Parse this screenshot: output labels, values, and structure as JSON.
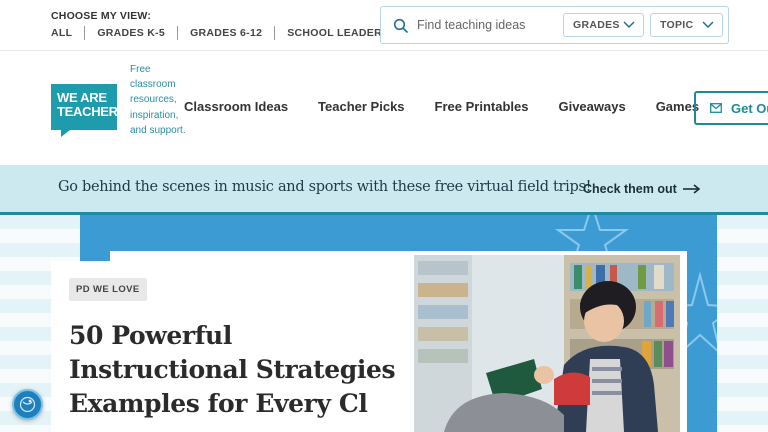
{
  "topbar": {
    "view_title": "CHOOSE MY VIEW:",
    "view_links": [
      "ALL",
      "GRADES K-5",
      "GRADES 6-12",
      "SCHOOL LEADERS"
    ],
    "search": {
      "placeholder": "Find teaching ideas",
      "icon": "search-icon"
    },
    "filters": [
      "GRADES",
      "TOPIC"
    ]
  },
  "header": {
    "logo_text": "WE ARE TEACHERS",
    "tagline": "Free classroom resources, inspiration, and support.",
    "nav": [
      "Classroom Ideas",
      "Teacher Picks",
      "Free Printables",
      "Giveaways",
      "Games"
    ],
    "cta_label": "Get Ou",
    "cta_icon": "mail-icon"
  },
  "promo": {
    "text": "Go behind the scenes in music and sports with these free virtual field trips!",
    "link_label": "Check them out",
    "link_icon": "arrow-right-icon"
  },
  "hero": {
    "badge": "PD WE LOVE",
    "headline": "50 Powerful Instructional Strategies Examples for Every Cl"
  },
  "colors": {
    "brand_teal": "#1e9bad",
    "promo_bg": "#cde9f0",
    "hero_blue": "#3d9bd4"
  }
}
